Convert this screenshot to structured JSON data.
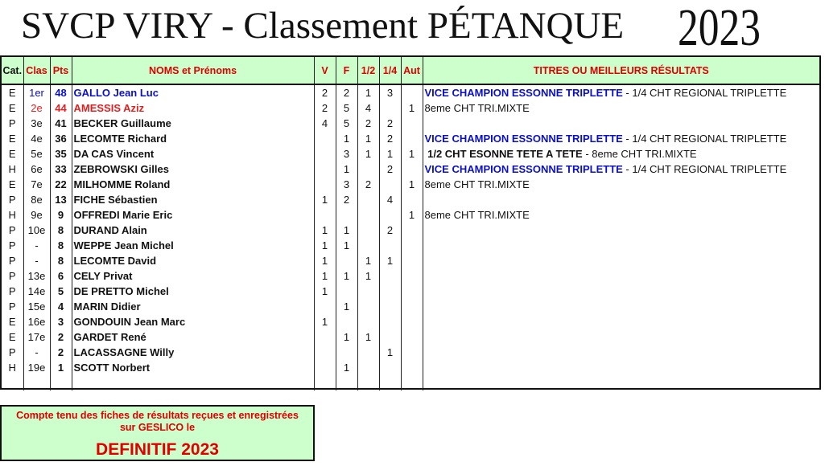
{
  "header": {
    "title": "SVCP VIRY - Classement PÉTANQUE",
    "year": "2023"
  },
  "table": {
    "columns": [
      "Cat.",
      "Clas",
      "Pts",
      "NOMS et Prénoms",
      "V",
      "F",
      "1/2",
      "1/4",
      "Aut",
      "TITRES OU MEILLEURS RÉSULTATS"
    ],
    "rows": [
      {
        "cat": "E",
        "clas": "1er",
        "pts": "48",
        "name": "GALLO Jean Luc",
        "v": "2",
        "f": "2",
        "demi": "1",
        "quart": "3",
        "aut": "",
        "style": "blue",
        "titre_main": "VICE CHAMPION ESSONNE TRIPLETTE",
        "titre_rest": " - 1/4 CHT REGIONAL TRIPLETTE",
        "titre_style": "blue"
      },
      {
        "cat": "E",
        "clas": "2e",
        "pts": "44",
        "name": "AMESSIS Aziz",
        "v": "2",
        "f": "5",
        "demi": "4",
        "quart": "",
        "aut": "1",
        "style": "red",
        "titre_main": "",
        "titre_rest": "8eme CHT TRI.MIXTE",
        "titre_style": ""
      },
      {
        "cat": "P",
        "clas": "3e",
        "pts": "41",
        "name": "BECKER Guillaume",
        "v": "4",
        "f": "5",
        "demi": "2",
        "quart": "2",
        "aut": "",
        "style": "",
        "titre_main": "",
        "titre_rest": "",
        "titre_style": ""
      },
      {
        "cat": "E",
        "clas": "4e",
        "pts": "36",
        "name": "LECOMTE Richard",
        "v": "",
        "f": "1",
        "demi": "1",
        "quart": "2",
        "aut": "",
        "style": "",
        "titre_main": "VICE CHAMPION ESSONNE TRIPLETTE",
        "titre_rest": " - 1/4 CHT REGIONAL TRIPLETTE",
        "titre_style": "blue"
      },
      {
        "cat": "E",
        "clas": "5e",
        "pts": "35",
        "name": "DA CAS Vincent",
        "v": "",
        "f": "3",
        "demi": "1",
        "quart": "1",
        "aut": "1",
        "style": "",
        "titre_main": " 1/2 CHT ESONNE TETE A TETE",
        "titre_rest": " - 8eme CHT TRI.MIXTE",
        "titre_style": "black"
      },
      {
        "cat": "H",
        "clas": "6e",
        "pts": "33",
        "name": "ZEBROWSKI Gilles",
        "v": "",
        "f": "1",
        "demi": "",
        "quart": "2",
        "aut": "",
        "style": "",
        "titre_main": "VICE CHAMPION ESSONNE TRIPLETTE",
        "titre_rest": " - 1/4 CHT REGIONAL TRIPLETTE",
        "titre_style": "blue"
      },
      {
        "cat": "E",
        "clas": "7e",
        "pts": "22",
        "name": "MILHOMME Roland",
        "v": "",
        "f": "3",
        "demi": "2",
        "quart": "",
        "aut": "1",
        "style": "",
        "titre_main": "",
        "titre_rest": "8eme CHT TRI.MIXTE",
        "titre_style": ""
      },
      {
        "cat": "P",
        "clas": "8e",
        "pts": "13",
        "name": "FICHE Sébastien",
        "v": "1",
        "f": "2",
        "demi": "",
        "quart": "4",
        "aut": "",
        "style": "",
        "titre_main": "",
        "titre_rest": "",
        "titre_style": ""
      },
      {
        "cat": "H",
        "clas": "9e",
        "pts": "9",
        "name": "OFFREDI Marie Eric",
        "v": "",
        "f": "",
        "demi": "",
        "quart": "",
        "aut": "1",
        "style": "",
        "titre_main": "",
        "titre_rest": "8eme CHT TRI.MIXTE",
        "titre_style": ""
      },
      {
        "cat": "P",
        "clas": "10e",
        "pts": "8",
        "name": "DURAND Alain",
        "v": "1",
        "f": "1",
        "demi": "",
        "quart": "2",
        "aut": "",
        "style": "",
        "titre_main": "",
        "titre_rest": "",
        "titre_style": ""
      },
      {
        "cat": "P",
        "clas": "-",
        "pts": "8",
        "name": "WEPPE Jean Michel",
        "v": "1",
        "f": "1",
        "demi": "",
        "quart": "",
        "aut": "",
        "style": "",
        "titre_main": "",
        "titre_rest": "",
        "titre_style": ""
      },
      {
        "cat": "P",
        "clas": "-",
        "pts": "8",
        "name": "LECOMTE David",
        "v": "1",
        "f": "",
        "demi": "1",
        "quart": "1",
        "aut": "",
        "style": "",
        "titre_main": "",
        "titre_rest": "",
        "titre_style": ""
      },
      {
        "cat": "P",
        "clas": "13e",
        "pts": "6",
        "name": "CELY Privat",
        "v": "1",
        "f": "1",
        "demi": "1",
        "quart": "",
        "aut": "",
        "style": "",
        "titre_main": "",
        "titre_rest": "",
        "titre_style": ""
      },
      {
        "cat": "P",
        "clas": "14e",
        "pts": "5",
        "name": "DE PRETTO Michel",
        "v": "1",
        "f": "",
        "demi": "",
        "quart": "",
        "aut": "",
        "style": "",
        "titre_main": "",
        "titre_rest": "",
        "titre_style": ""
      },
      {
        "cat": "P",
        "clas": "15e",
        "pts": "4",
        "name": "MARIN Didier",
        "v": "",
        "f": "1",
        "demi": "",
        "quart": "",
        "aut": "",
        "style": "",
        "titre_main": "",
        "titre_rest": "",
        "titre_style": ""
      },
      {
        "cat": "E",
        "clas": "16e",
        "pts": "3",
        "name": "GONDOUIN Jean Marc",
        "v": "1",
        "f": "",
        "demi": "",
        "quart": "",
        "aut": "",
        "style": "",
        "titre_main": "",
        "titre_rest": "",
        "titre_style": ""
      },
      {
        "cat": "E",
        "clas": "17e",
        "pts": "2",
        "name": "GARDET René",
        "v": "",
        "f": "1",
        "demi": "1",
        "quart": "",
        "aut": "",
        "style": "",
        "titre_main": "",
        "titre_rest": "",
        "titre_style": ""
      },
      {
        "cat": "P",
        "clas": "-",
        "pts": "2",
        "name": "LACASSAGNE Willy",
        "v": "",
        "f": "",
        "demi": "",
        "quart": "1",
        "aut": "",
        "style": "",
        "titre_main": "",
        "titre_rest": "",
        "titre_style": ""
      },
      {
        "cat": "H",
        "clas": "19e",
        "pts": "1",
        "name": "SCOTT Norbert",
        "v": "",
        "f": "1",
        "demi": "",
        "quart": "",
        "aut": "",
        "style": "",
        "titre_main": "",
        "titre_rest": "",
        "titre_style": ""
      }
    ]
  },
  "note": {
    "line1": "Compte tenu des fiches de résultats reçues et enregistrées",
    "line2": "sur GESLICO le",
    "status": "DEFINITIF 2023"
  }
}
